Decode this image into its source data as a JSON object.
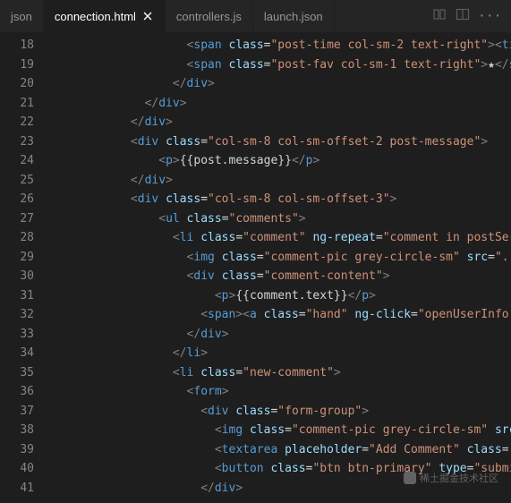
{
  "tabs": [
    {
      "label": "json",
      "close": false
    },
    {
      "label": "connection.html",
      "close": true,
      "active": true
    },
    {
      "label": "controllers.js",
      "close": false
    },
    {
      "label": "launch.json",
      "close": false
    }
  ],
  "watermark": "稀土掘金技术社区",
  "gutter_start": 18,
  "lines": [
    [
      {
        "ind": 20
      },
      {
        "c": "brk",
        "t": "<"
      },
      {
        "c": "tag",
        "t": "span"
      },
      {
        "t": " "
      },
      {
        "c": "attr",
        "t": "class"
      },
      {
        "c": "txt",
        "t": "="
      },
      {
        "c": "str",
        "t": "\"post-time col-sm-2 text-right\""
      },
      {
        "c": "brk",
        "t": "><"
      },
      {
        "c": "tag",
        "t": "ti"
      }
    ],
    [
      {
        "ind": 20
      },
      {
        "c": "brk",
        "t": "<"
      },
      {
        "c": "tag",
        "t": "span"
      },
      {
        "t": " "
      },
      {
        "c": "attr",
        "t": "class"
      },
      {
        "c": "txt",
        "t": "="
      },
      {
        "c": "str",
        "t": "\"post-fav col-sm-1 text-right\""
      },
      {
        "c": "brk",
        "t": ">"
      },
      {
        "c": "txt",
        "t": "★"
      },
      {
        "c": "brk",
        "t": "</"
      },
      {
        "c": "tag",
        "t": "s"
      }
    ],
    [
      {
        "ind": 18
      },
      {
        "c": "brk",
        "t": "</"
      },
      {
        "c": "tag",
        "t": "div"
      },
      {
        "c": "brk",
        "t": ">"
      }
    ],
    [
      {
        "ind": 14
      },
      {
        "c": "brk",
        "t": "</"
      },
      {
        "c": "tag",
        "t": "div"
      },
      {
        "c": "brk",
        "t": ">"
      }
    ],
    [
      {
        "ind": 12
      },
      {
        "c": "brk",
        "t": "</"
      },
      {
        "c": "tag",
        "t": "div"
      },
      {
        "c": "brk",
        "t": ">"
      }
    ],
    [
      {
        "ind": 12
      },
      {
        "c": "brk",
        "t": "<"
      },
      {
        "c": "tag",
        "t": "div"
      },
      {
        "t": " "
      },
      {
        "c": "attr",
        "t": "class"
      },
      {
        "c": "txt",
        "t": "="
      },
      {
        "c": "str",
        "t": "\"col-sm-8 col-sm-offset-2 post-message\""
      },
      {
        "c": "brk",
        "t": ">"
      }
    ],
    [
      {
        "ind": 16
      },
      {
        "c": "brk",
        "t": "<"
      },
      {
        "c": "tag",
        "t": "p"
      },
      {
        "c": "brk",
        "t": ">"
      },
      {
        "c": "txt",
        "t": "{{post.message}}"
      },
      {
        "c": "brk",
        "t": "</"
      },
      {
        "c": "tag",
        "t": "p"
      },
      {
        "c": "brk",
        "t": ">"
      }
    ],
    [
      {
        "ind": 12
      },
      {
        "c": "brk",
        "t": "</"
      },
      {
        "c": "tag",
        "t": "div"
      },
      {
        "c": "brk",
        "t": ">"
      }
    ],
    [
      {
        "ind": 12
      },
      {
        "c": "brk",
        "t": "<"
      },
      {
        "c": "tag",
        "t": "div"
      },
      {
        "t": " "
      },
      {
        "c": "attr",
        "t": "class"
      },
      {
        "c": "txt",
        "t": "="
      },
      {
        "c": "str",
        "t": "\"col-sm-8 col-sm-offset-3\""
      },
      {
        "c": "brk",
        "t": ">"
      }
    ],
    [
      {
        "ind": 16
      },
      {
        "c": "brk",
        "t": "<"
      },
      {
        "c": "tag",
        "t": "ul"
      },
      {
        "t": " "
      },
      {
        "c": "attr",
        "t": "class"
      },
      {
        "c": "txt",
        "t": "="
      },
      {
        "c": "str",
        "t": "\"comments\""
      },
      {
        "c": "brk",
        "t": ">"
      }
    ],
    [
      {
        "ind": 18
      },
      {
        "c": "brk",
        "t": "<"
      },
      {
        "c": "tag",
        "t": "li"
      },
      {
        "t": " "
      },
      {
        "c": "attr",
        "t": "class"
      },
      {
        "c": "txt",
        "t": "="
      },
      {
        "c": "str",
        "t": "\"comment\""
      },
      {
        "t": " "
      },
      {
        "c": "attr",
        "t": "ng-repeat"
      },
      {
        "c": "txt",
        "t": "="
      },
      {
        "c": "str",
        "t": "\"comment in postSer"
      }
    ],
    [
      {
        "ind": 20
      },
      {
        "c": "brk",
        "t": "<"
      },
      {
        "c": "tag",
        "t": "img"
      },
      {
        "t": " "
      },
      {
        "c": "attr",
        "t": "class"
      },
      {
        "c": "txt",
        "t": "="
      },
      {
        "c": "str",
        "t": "\"comment-pic grey-circle-sm\""
      },
      {
        "t": " "
      },
      {
        "c": "attr",
        "t": "src"
      },
      {
        "c": "txt",
        "t": "="
      },
      {
        "c": "str",
        "t": "\"..."
      }
    ],
    [
      {
        "ind": 20
      },
      {
        "c": "brk",
        "t": "<"
      },
      {
        "c": "tag",
        "t": "div"
      },
      {
        "t": " "
      },
      {
        "c": "attr",
        "t": "class"
      },
      {
        "c": "txt",
        "t": "="
      },
      {
        "c": "str",
        "t": "\"comment-content\""
      },
      {
        "c": "brk",
        "t": ">"
      }
    ],
    [
      {
        "ind": 24
      },
      {
        "c": "brk",
        "t": "<"
      },
      {
        "c": "tag",
        "t": "p"
      },
      {
        "c": "brk",
        "t": ">"
      },
      {
        "c": "txt",
        "t": "{{comment.text}}"
      },
      {
        "c": "brk",
        "t": "</"
      },
      {
        "c": "tag",
        "t": "p"
      },
      {
        "c": "brk",
        "t": ">"
      }
    ],
    [
      {
        "ind": 22
      },
      {
        "c": "brk",
        "t": "<"
      },
      {
        "c": "tag",
        "t": "span"
      },
      {
        "c": "brk",
        "t": "><"
      },
      {
        "c": "tag",
        "t": "a"
      },
      {
        "t": " "
      },
      {
        "c": "attr",
        "t": "class"
      },
      {
        "c": "txt",
        "t": "="
      },
      {
        "c": "str",
        "t": "\"hand\""
      },
      {
        "t": " "
      },
      {
        "c": "attr",
        "t": "ng-click"
      },
      {
        "c": "txt",
        "t": "="
      },
      {
        "c": "str",
        "t": "\"openUserInfo("
      }
    ],
    [
      {
        "ind": 20
      },
      {
        "c": "brk",
        "t": "</"
      },
      {
        "c": "tag",
        "t": "div"
      },
      {
        "c": "brk",
        "t": ">"
      }
    ],
    [
      {
        "ind": 18
      },
      {
        "c": "brk",
        "t": "</"
      },
      {
        "c": "tag",
        "t": "li"
      },
      {
        "c": "brk",
        "t": ">"
      }
    ],
    [
      {
        "ind": 18
      },
      {
        "c": "brk",
        "t": "<"
      },
      {
        "c": "tag",
        "t": "li"
      },
      {
        "t": " "
      },
      {
        "c": "attr",
        "t": "class"
      },
      {
        "c": "txt",
        "t": "="
      },
      {
        "c": "str",
        "t": "\"new-comment\""
      },
      {
        "c": "brk",
        "t": ">"
      }
    ],
    [
      {
        "ind": 20
      },
      {
        "c": "brk",
        "t": "<"
      },
      {
        "c": "tag",
        "t": "form"
      },
      {
        "c": "brk",
        "t": ">"
      }
    ],
    [
      {
        "ind": 22
      },
      {
        "c": "brk",
        "t": "<"
      },
      {
        "c": "tag",
        "t": "div"
      },
      {
        "t": " "
      },
      {
        "c": "attr",
        "t": "class"
      },
      {
        "c": "txt",
        "t": "="
      },
      {
        "c": "str",
        "t": "\"form-group\""
      },
      {
        "c": "brk",
        "t": ">"
      }
    ],
    [
      {
        "ind": 24
      },
      {
        "c": "brk",
        "t": "<"
      },
      {
        "c": "tag",
        "t": "img"
      },
      {
        "t": " "
      },
      {
        "c": "attr",
        "t": "class"
      },
      {
        "c": "txt",
        "t": "="
      },
      {
        "c": "str",
        "t": "\"comment-pic grey-circle-sm\""
      },
      {
        "t": " "
      },
      {
        "c": "attr",
        "t": "src"
      }
    ],
    [
      {
        "ind": 24
      },
      {
        "c": "brk",
        "t": "<"
      },
      {
        "c": "tag",
        "t": "textarea"
      },
      {
        "t": " "
      },
      {
        "c": "attr",
        "t": "placeholder"
      },
      {
        "c": "txt",
        "t": "="
      },
      {
        "c": "str",
        "t": "\"Add Comment\""
      },
      {
        "t": " "
      },
      {
        "c": "attr",
        "t": "class"
      },
      {
        "c": "txt",
        "t": "="
      }
    ],
    [
      {
        "ind": 24
      },
      {
        "c": "brk",
        "t": "<"
      },
      {
        "c": "tag",
        "t": "button"
      },
      {
        "t": " "
      },
      {
        "c": "attr",
        "t": "class"
      },
      {
        "c": "txt",
        "t": "="
      },
      {
        "c": "str",
        "t": "\"btn btn-primary\""
      },
      {
        "t": " "
      },
      {
        "c": "attr",
        "t": "type"
      },
      {
        "c": "txt",
        "t": "="
      },
      {
        "c": "str",
        "t": "\"submi"
      }
    ],
    [
      {
        "ind": 22
      },
      {
        "c": "brk",
        "t": "</"
      },
      {
        "c": "tag",
        "t": "div"
      },
      {
        "c": "brk",
        "t": ">"
      }
    ]
  ]
}
